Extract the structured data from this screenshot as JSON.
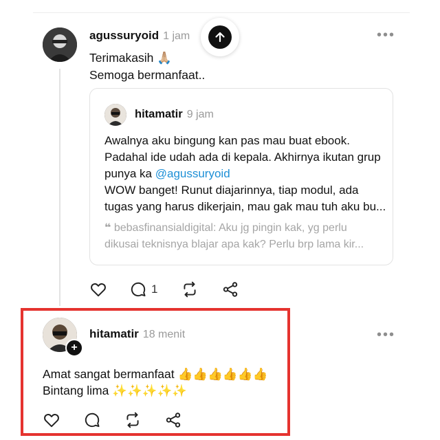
{
  "post": {
    "username": "agussuryoid",
    "time": "1 jam",
    "line1": "Terimakasih 🙏🏼",
    "line2": "Semoga bermanfaat..",
    "quoted": {
      "username": "hitamatir",
      "time": "9 jam",
      "text_a": "Awalnya aku bingung kan pas mau buat ebook.",
      "text_b": "Padahal ide udah ada di kepala. Akhirnya ikutan grup",
      "text_c_pre": "punya ka ",
      "mention": "@agussuryoid",
      "text_d": "WOW banget! Runut diajarinnya, tiap modul, ada",
      "text_e": "tugas yang harus dikerjain, mau gak mau tuh aku bu...",
      "nested_quote_1": "bebasfinansialdigital: Aku jg pingin kak, yg perlu",
      "nested_quote_2": "dikusai teknisnya blajar apa kak? Perlu brp lama kir..."
    },
    "reply_count": "1"
  },
  "reply": {
    "username": "hitamatir",
    "time": "18 menit",
    "line1": "Amat sangat bermanfaat 👍👍👍👍👍👍",
    "line2": "Bintang lima ✨✨✨✨✨"
  },
  "icons": {
    "more": "more-horizontal-icon",
    "like": "heart-icon",
    "reply": "comment-bubble-icon",
    "repost": "repost-icon",
    "share": "share-icon",
    "scroll_top": "arrow-up-icon",
    "follow": "plus-icon"
  },
  "colors": {
    "highlight": "#e5332f",
    "mention": "#1d8fd6",
    "muted": "#9a9a9a"
  }
}
